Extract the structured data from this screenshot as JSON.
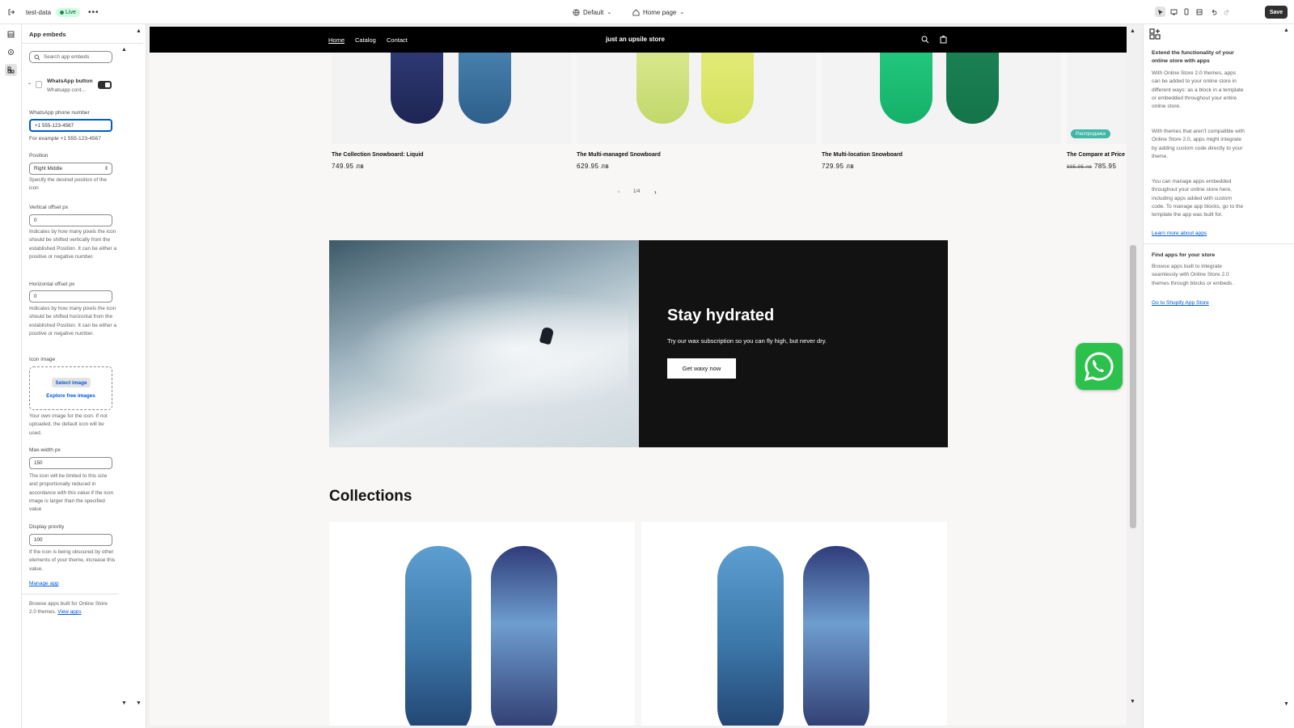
{
  "topbar": {
    "store_name": "test-data",
    "status": "Live",
    "theme": "Default",
    "page": "Home page",
    "save_label": "Save"
  },
  "sidebar": {
    "title": "App embeds",
    "search_placeholder": "Search app embeds",
    "embed_name": "WhatsApp button",
    "embed_sub": "Whatsapp cont...",
    "phone_label": "WhatsApp phone number",
    "phone_value": "+1 555-123-4567",
    "phone_help": "For example +1 555-123-4567",
    "position_label": "Position",
    "position_value": "Right Middle",
    "position_help": "Specify the desired position of the icon",
    "voffset_label": "Vertical offset px",
    "voffset_value": "0",
    "voffset_help": "Indicates by how many pixels the icon should be shifted vertically from the established Position. It can be either a positive or negative number.",
    "hoffset_label": "Horizontal offset px",
    "hoffset_value": "0",
    "hoffset_help": "Indicates by how many pixels the icon should be shifted horizontal from the established Position. It can be either a positive or negative number.",
    "icon_label": "Icon image",
    "select_image": "Select image",
    "explore_images": "Explore free images",
    "icon_help": "Your own image for the icon. If not uploaded, the default icon will be used.",
    "maxwidth_label": "Max-width px",
    "maxwidth_value": "150",
    "maxwidth_help": "The icon will be limited to this size and proportionally reduced in accordance with this value if the icon image is larger than the specified value",
    "priority_label": "Display priority",
    "priority_value": "100",
    "priority_help": "If the icon is being obscured by other elements of your theme, increase this value.",
    "manage_app": "Manage app",
    "browse_text": "Browse apps built for Online Store 2.0 themes.",
    "view_apps": "View apps"
  },
  "store": {
    "nav": [
      "Home",
      "Catalog",
      "Contact"
    ],
    "store_title": "just an upsile store",
    "products": [
      {
        "title": "The Collection Snowboard: Liquid",
        "price": "749.95 лв"
      },
      {
        "title": "The Multi-managed Snowboard",
        "price": "629.95 лв"
      },
      {
        "title": "The Multi-location Snowboard",
        "price": "729.95 лв"
      },
      {
        "title": "The Compare at Price",
        "old_price": "885.95 лв",
        "price": "785.95",
        "badge": "Распродажа"
      }
    ],
    "pagination": "1/4",
    "hero_heading": "Stay hydrated",
    "hero_text": "Try our wax subscription so you can fly high, but never dry.",
    "hero_button": "Get waxy now",
    "collections_heading": "Collections"
  },
  "rightpanel": {
    "heading": "Extend the functionality of your online store with apps",
    "p1": "With Online Store 2.0 themes, apps can be added to your online store in different ways: as a block in a template or embedded throughout your entire online store.",
    "p2": "With themes that aren't compatible with Online Store 2.0, apps might integrate by adding custom code directly to your theme.",
    "p3": "You can manage apps embedded throughout your online store here, including apps added with custom code. To manage app blocks, go to the template the app was built for.",
    "learn_more": "Learn more about apps",
    "find_heading": "Find apps for your store",
    "find_text": "Browse apps built to integrate seamlessly with Online Store 2.0 themes through blocks or embeds.",
    "app_store_link": "Go to Shopify App Store"
  },
  "colors": {
    "accent_link": "#005bd3",
    "whatsapp_green": "#2cc04d",
    "badge_teal": "#3fb7a7"
  }
}
